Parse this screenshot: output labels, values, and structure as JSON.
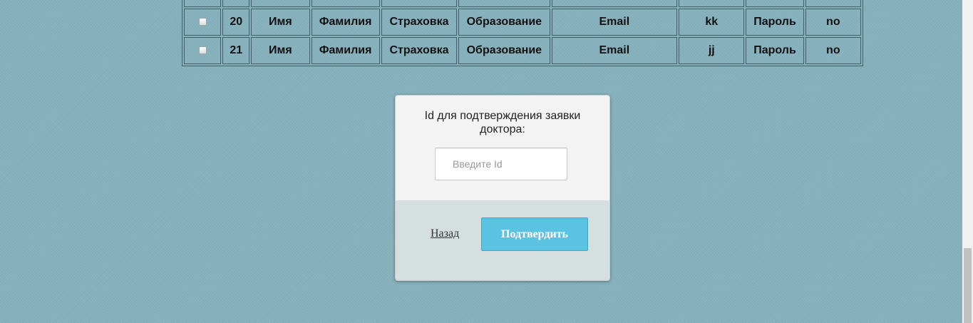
{
  "table": {
    "rows": [
      {
        "id": "",
        "first_name": "",
        "last_name": "",
        "insurance": "",
        "education": "",
        "email": "",
        "login": "",
        "password": "",
        "status": ""
      },
      {
        "id": "20",
        "first_name": "Имя",
        "last_name": "Фамилия",
        "insurance": "Страховка",
        "education": "Образование",
        "email": "Email",
        "login": "kk",
        "password": "Пароль",
        "status": "no"
      },
      {
        "id": "21",
        "first_name": "Имя",
        "last_name": "Фамилия",
        "insurance": "Страховка",
        "education": "Образование",
        "email": "Email",
        "login": "jj",
        "password": "Пароль",
        "status": "no"
      }
    ]
  },
  "modal": {
    "prompt": "Id для подтверждения заявки доктора:",
    "input_placeholder": "Введите Id",
    "input_value": "",
    "back_label": "Назад",
    "confirm_label": "Подтвердить"
  }
}
